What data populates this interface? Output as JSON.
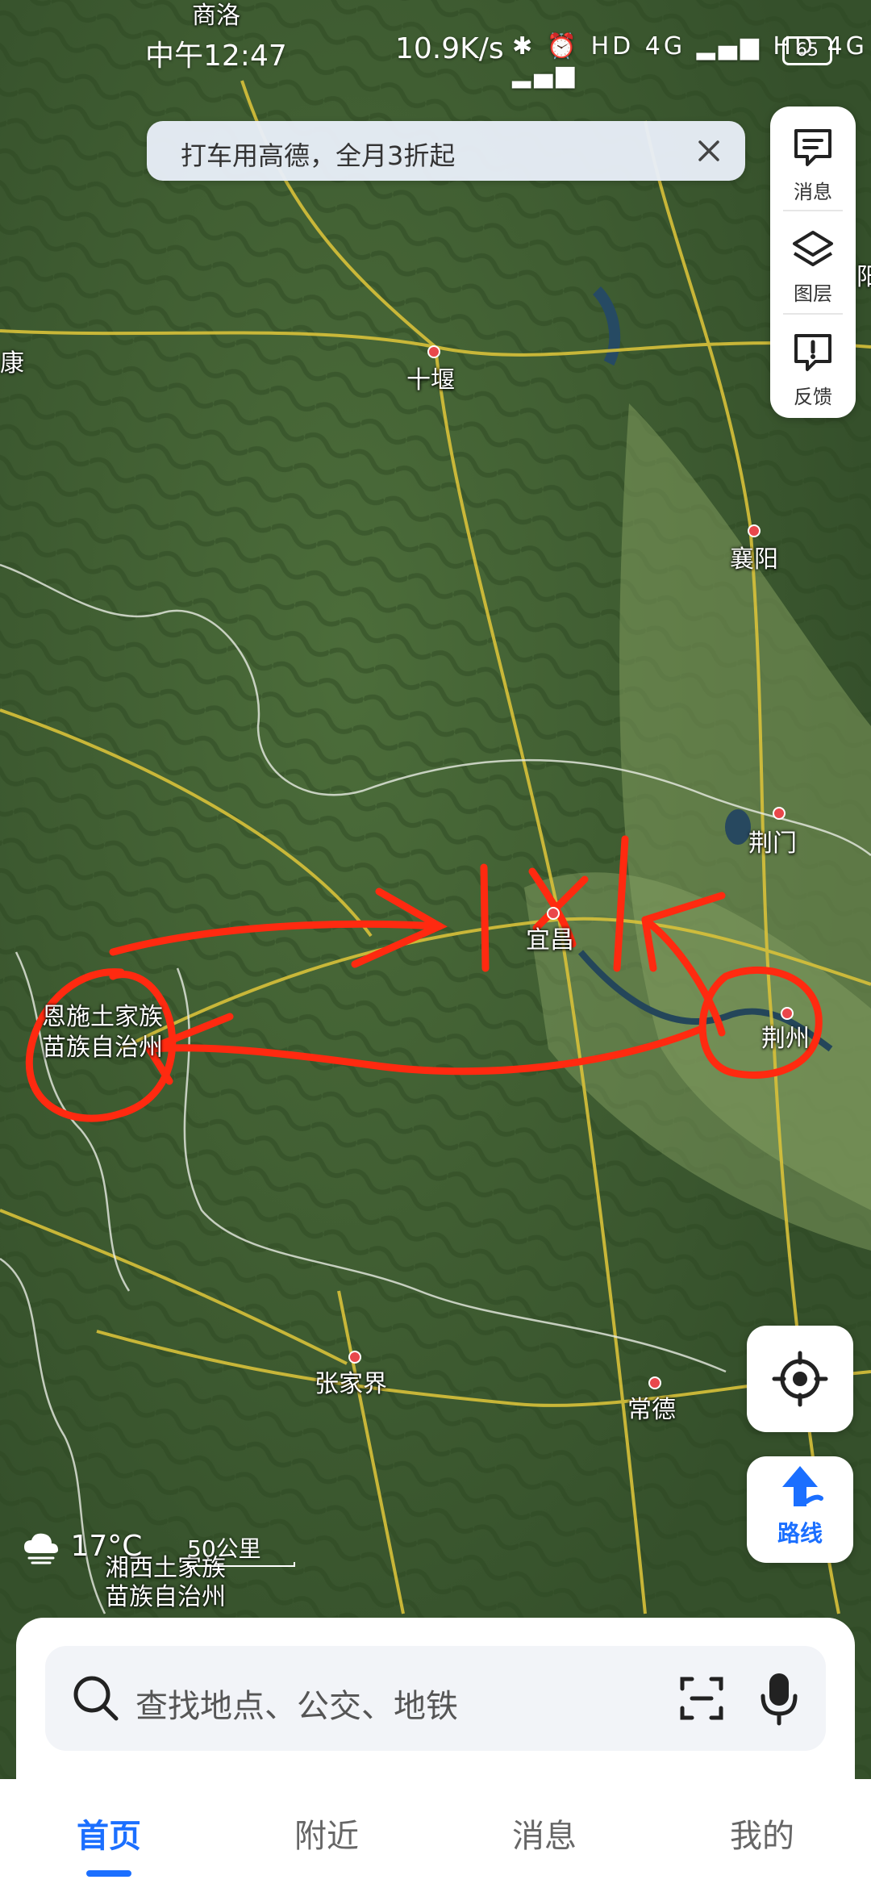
{
  "status_bar": {
    "time": "中午12:47",
    "network_speed": "10.9K/s",
    "battery": "65",
    "icons_text": "✱ ⏰ HD 4G ▂▄▆ HD 4G ▂▄▆"
  },
  "banner": {
    "text": "打车用高德，全月3折起"
  },
  "side_panel": [
    {
      "label": "消息",
      "icon": "message-icon"
    },
    {
      "label": "图层",
      "icon": "layers-icon"
    },
    {
      "label": "反馈",
      "icon": "feedback-icon"
    }
  ],
  "map": {
    "cities": {
      "shangluo": "商洛",
      "shiyan": "十堰",
      "xiangyang": "襄阳",
      "jingmen": "荆门",
      "yichang": "宜昌",
      "jingzhou": "荆州",
      "enshi": "恩施土家族\n苗族自治州",
      "zhangjiajie": "张家界",
      "changde": "常德",
      "xiangxi": "湘西土家族\n苗族自治州",
      "ankang": "康",
      "right_edge": "阳"
    },
    "weather": "17°C",
    "scale": "50公里"
  },
  "controls": {
    "route_label": "路线"
  },
  "search": {
    "placeholder": "查找地点、公交、地铁"
  },
  "tabs": [
    "首页",
    "附近",
    "消息",
    "我的"
  ],
  "colors": {
    "accent": "#1b6fff",
    "annotation": "#ff2a10",
    "city_dot": "#e9474b"
  }
}
